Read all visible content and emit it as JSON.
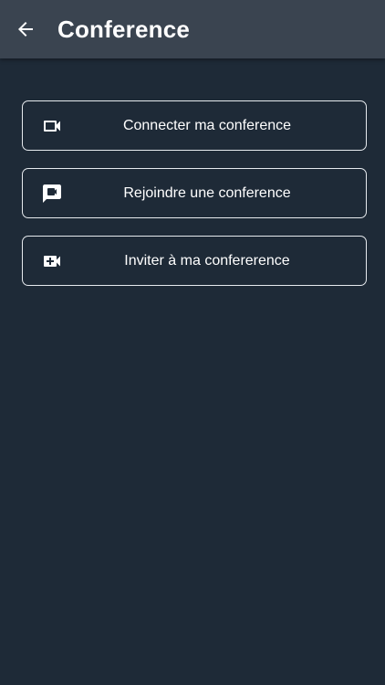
{
  "header": {
    "title": "Conference",
    "back_icon": "arrow-left-icon"
  },
  "actions": [
    {
      "label": "Connecter ma conference",
      "icon": "videocam-outline-icon"
    },
    {
      "label": "Rejoindre une conference",
      "icon": "video-chat-icon"
    },
    {
      "label": "Inviter à ma confererence",
      "icon": "video-call-add-icon"
    }
  ],
  "colors": {
    "background": "#1e2a37",
    "app_bar": "#3a4450",
    "text": "#ffffff",
    "button_border": "#e6eaee"
  }
}
